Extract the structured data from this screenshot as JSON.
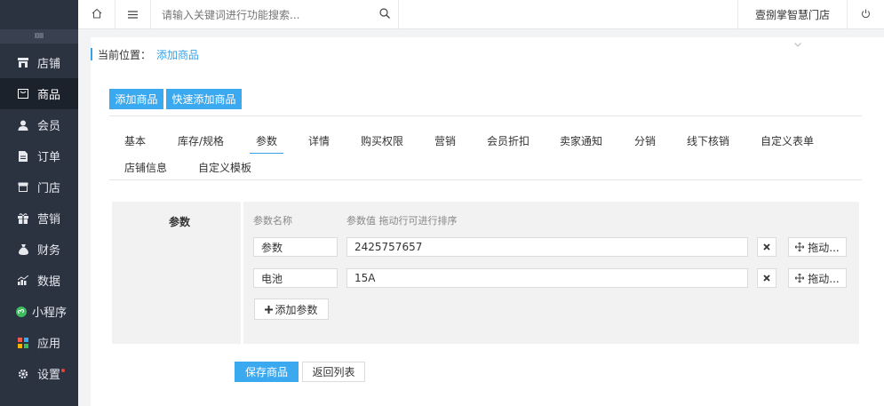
{
  "sidebar": {
    "collapse_icon": "collapse-icon",
    "items": [
      {
        "label": "店铺",
        "icon": "store-icon",
        "active": false
      },
      {
        "label": "商品",
        "icon": "goods-icon",
        "active": true
      },
      {
        "label": "会员",
        "icon": "user-icon",
        "active": false
      },
      {
        "label": "订单",
        "icon": "order-icon",
        "active": false
      },
      {
        "label": "门店",
        "icon": "shop-icon",
        "active": false
      },
      {
        "label": "营销",
        "icon": "gift-icon",
        "active": false
      },
      {
        "label": "财务",
        "icon": "money-bag-icon",
        "active": false
      },
      {
        "label": "数据",
        "icon": "chart-icon",
        "active": false
      },
      {
        "label": "小程序",
        "icon": "miniapp-icon",
        "active": false
      },
      {
        "label": "应用",
        "icon": "apps-icon",
        "active": false
      },
      {
        "label": "设置",
        "icon": "gear-icon",
        "active": false
      }
    ]
  },
  "topbar": {
    "search_placeholder": "请输入关键词进行功能搜索...",
    "store_name": "壹捌掌智慧门店"
  },
  "breadcrumb": {
    "label": "当前位置：",
    "current": "添加商品"
  },
  "actions": {
    "add_goods": "添加商品",
    "quick_add_goods": "快速添加商品"
  },
  "tabs": [
    {
      "label": "基本"
    },
    {
      "label": "库存/规格"
    },
    {
      "label": "参数",
      "active": true
    },
    {
      "label": "详情"
    },
    {
      "label": "购买权限"
    },
    {
      "label": "营销"
    },
    {
      "label": "会员折扣"
    },
    {
      "label": "卖家通知"
    },
    {
      "label": "分销"
    },
    {
      "label": "线下核销"
    },
    {
      "label": "自定义表单"
    },
    {
      "label": "店铺信息"
    },
    {
      "label": "自定义模板"
    }
  ],
  "params": {
    "section_label": "参数",
    "col_name": "参数名称",
    "col_value": "参数值 拖动行可进行排序",
    "rows": [
      {
        "name": "参数",
        "value": "2425757657",
        "drag_label": "拖动..."
      },
      {
        "name": "电池",
        "value": "15A",
        "drag_label": "拖动..."
      }
    ],
    "add_label": "添加参数"
  },
  "footer": {
    "save": "保存商品",
    "back": "返回列表"
  },
  "colors": {
    "sidebar_bg": "#2b3240",
    "accent": "#3aa9ef"
  }
}
